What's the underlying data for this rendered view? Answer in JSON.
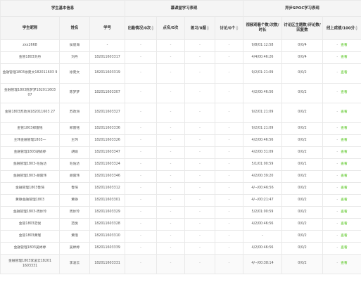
{
  "header": {
    "groups": {
      "basic": "学生基本信息",
      "classroom": "慕课堂学习表现",
      "spoc": "异步SPOC学习表现"
    },
    "columns": {
      "nickname": "学生昵称",
      "name": "姓名",
      "student_id": "学号",
      "attendance": "出勤情况/0次",
      "rollcall": "点名/0次",
      "exercise": "练习/0题",
      "discussion": "讨论/0个",
      "video": "视频观看个数/次数/时长",
      "forum": "讨论区主题数/评论数/回复数",
      "score": "线上成绩/100分"
    }
  },
  "action_label": "查看",
  "dash": "-",
  "colors": {
    "link": "#52c41a",
    "header_bg": "#f5f5f5",
    "border": "#e9e9e9"
  },
  "rows": [
    {
      "nickname": "zxx2668",
      "name": "侯俊海",
      "student_id": "-",
      "video": "9/8/01:12:58",
      "forum": "0/0/4",
      "tall": false
    },
    {
      "nickname": "金管1803刘丹",
      "name": "刘丹",
      "student_id": "182011603317",
      "video": "4/4/00:46:26",
      "forum": "0/0/4",
      "tall": false
    },
    {
      "nickname": "金融管理1803徐夏文182011603 9",
      "name": "徐夏文",
      "student_id": "182011603319",
      "video": "9/2/01:21:09",
      "forum": "0/0/2",
      "tall": true
    },
    {
      "nickname": "金融管理1803陈梦梦182011603 07",
      "name": "陈梦梦",
      "student_id": "182011603307",
      "video": "4/2/00:46:56",
      "forum": "0/0/2",
      "tall": true
    },
    {
      "nickname": "金管1803苏政洲182011603 27",
      "name": "苏政洲",
      "student_id": "182011603327",
      "video": "9/2/01:21:09",
      "forum": "0/0/2",
      "tall": true
    },
    {
      "nickname": "金管1803郑雷铭",
      "name": "郑雷铭",
      "student_id": "182011603336",
      "video": "9/2/01:21:09",
      "forum": "0/0/2",
      "tall": false
    },
    {
      "nickname": "王玮金融管理1803—",
      "name": "王玮",
      "student_id": "182011603326",
      "video": "4/2/00:46:56",
      "forum": "0/0/2",
      "tall": false
    },
    {
      "nickname": "金融管理1803胡娟婷",
      "name": "胡娟",
      "student_id": "182011603347",
      "video": "4/2/00:31:09",
      "forum": "0/0/2",
      "tall": false
    },
    {
      "nickname": "金融管理1803-毛佑达",
      "name": "毛佑达",
      "student_id": "182011603324",
      "video": "5/1/01:00:59",
      "forum": "0/0/1",
      "tall": false
    },
    {
      "nickname": "金融管理1803-胡雷玮",
      "name": "胡雷玮",
      "student_id": "182011603346",
      "video": "4/2/00:39:20",
      "forum": "0/0/2",
      "tall": false
    },
    {
      "nickname": "金融管理1803鲁琦",
      "name": "鲁琦",
      "student_id": "182011603312",
      "video": "4/--/00:46:56",
      "forum": "0/0/2",
      "tall": false
    },
    {
      "nickname": "黄铮金融管理1803",
      "name": "黄铮",
      "student_id": "182011603301",
      "video": "4/--/00:21:47",
      "forum": "0/0/2",
      "tall": false
    },
    {
      "nickname": "金融管理1803-周妙玲",
      "name": "周妙玲",
      "student_id": "182011603329",
      "video": "5/2/01:00:59",
      "forum": "0/0/2",
      "tall": false
    },
    {
      "nickname": "金管1803范悦",
      "name": "范悦",
      "student_id": "182011603328",
      "video": "4/2/00:46:56",
      "forum": "0/0/2",
      "tall": false
    },
    {
      "nickname": "金管1803黄瑾",
      "name": "黄瑾",
      "student_id": "182011603310",
      "video": "-",
      "forum": "0/0/2",
      "tall": false
    },
    {
      "nickname": "金融管理1803吴婷婷",
      "name": "吴婷婷",
      "student_id": "182011603339",
      "video": "4/2/00:46:56",
      "forum": "0/0/2",
      "tall": false
    },
    {
      "nickname": "金融管理1803李凌云18201 1603331",
      "name": "李凌云",
      "student_id": "182011603331",
      "video": "4/--/00:38:14",
      "forum": "0/0/2",
      "tall": true
    }
  ]
}
